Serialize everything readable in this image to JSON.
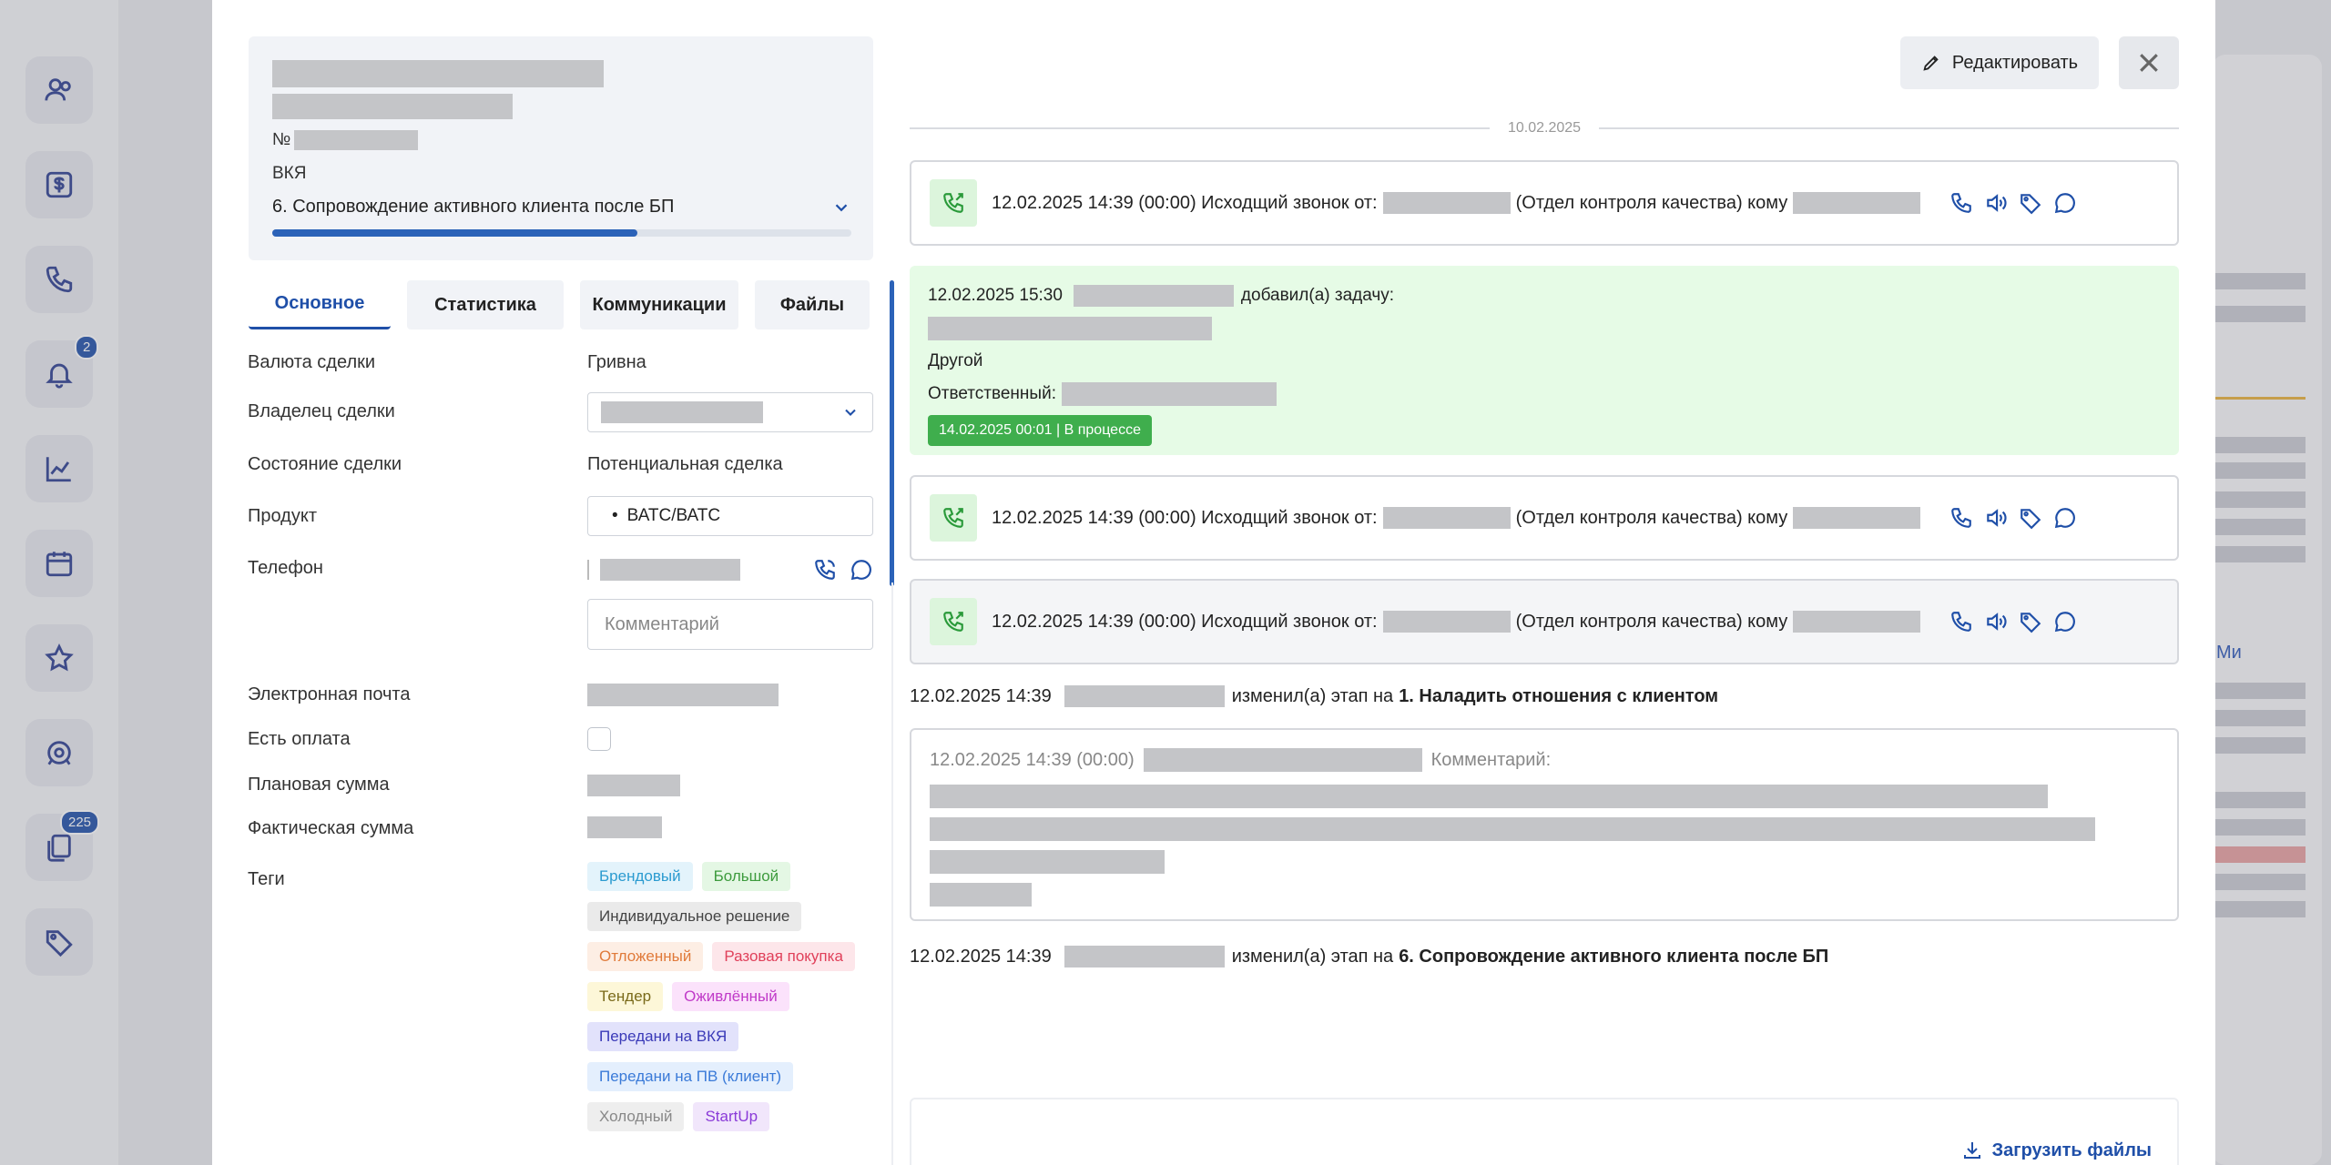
{
  "sidebar": {
    "notifications_badge": "2",
    "docs_badge": "225"
  },
  "background": {
    "right_link": "Ми"
  },
  "deal_header": {
    "number_prefix": "№",
    "group": "ВКЯ",
    "stage": "6. Сопровождение активного клиента после БП",
    "progress_fraction": 0.63
  },
  "tabs": [
    {
      "label": "Основное",
      "active": true
    },
    {
      "label": "Статистика",
      "active": false
    },
    {
      "label": "Коммуникации",
      "active": false
    },
    {
      "label": "Файлы",
      "active": false
    }
  ],
  "fields": {
    "currency_label": "Валюта сделки",
    "currency_value": "Гривна",
    "owner_label": "Владелец сделки",
    "state_label": "Состояние сделки",
    "state_value": "Потенциальная сделка",
    "product_label": "Продукт",
    "product_value": "ВАТС/ВАТС",
    "product_bullet": "•",
    "phone_label": "Телефон",
    "comment_placeholder": "Комментарий",
    "email_label": "Электронная почта",
    "payment_label": "Есть оплата",
    "planned_label": "Плановая сумма",
    "actual_label": "Фактическая сумма",
    "tags_label": "Теги"
  },
  "tags": [
    [
      {
        "label": "Брендовый",
        "bg": "#e3f3fb",
        "fg": "#2b9bd0"
      },
      {
        "label": "Большой",
        "bg": "#e4f7e4",
        "fg": "#3d9b3d"
      }
    ],
    [
      {
        "label": "Индивидуальное решение",
        "bg": "#eaeaea",
        "fg": "#444444"
      }
    ],
    [
      {
        "label": "Отложенный",
        "bg": "#fdeee4",
        "fg": "#e07a3a"
      },
      {
        "label": "Разовая покупка",
        "bg": "#fde6ea",
        "fg": "#e0405a"
      }
    ],
    [
      {
        "label": "Тендер",
        "bg": "#fdf7d8",
        "fg": "#7a6a1a"
      },
      {
        "label": "Оживлённый",
        "bg": "#fbe2fb",
        "fg": "#c03ac8"
      }
    ],
    [
      {
        "label": "Передани на ВКЯ",
        "bg": "#e2e2fb",
        "fg": "#3a3ab8"
      }
    ],
    [
      {
        "label": "Передани на ПВ (клиент)",
        "bg": "#e4effd",
        "fg": "#3a7ad8"
      }
    ],
    [
      {
        "label": "Холодный",
        "bg": "#eeeeee",
        "fg": "#888888"
      },
      {
        "label": "StartUp",
        "bg": "#f1e6fb",
        "fg": "#8a3ad8"
      }
    ]
  ],
  "actions": {
    "edit_label": "Редактировать",
    "upload_label": "Загрузить файлы"
  },
  "timeline": {
    "date_separator": "10.02.2025",
    "calls": [
      {
        "text_before": "12.02.2025 14:39 (00:00) Исходщий звонок от:",
        "dept": "(Отдел контроля качества) кому"
      },
      {
        "text_before": "12.02.2025 14:39 (00:00) Исходщий звонок от:",
        "dept": "(Отдел контроля качества) кому"
      },
      {
        "text_before": "12.02.2025 14:39 (00:00) Исходщий звонок от:",
        "dept": "(Отдел контроля качества) кому"
      }
    ],
    "task": {
      "datetime": "12.02.2025 15:30",
      "action": "добавил(а) задачу:",
      "type": "Другой",
      "responsible_label": "Ответственный:",
      "status": "14.02.2025 00:01 | В процессе"
    },
    "stage_change_1": {
      "datetime": "12.02.2025 14:39",
      "action": "изменил(а) этап на",
      "stage": "1. Наладить отношения с клиентом"
    },
    "comment": {
      "datetime": "12.02.2025 14:39 (00:00)",
      "label": "Комментарий:"
    },
    "stage_change_2": {
      "datetime": "12.02.2025 14:39",
      "action": "изменил(а) этап на",
      "stage": "6. Сопровождение активного клиента после БП"
    }
  }
}
